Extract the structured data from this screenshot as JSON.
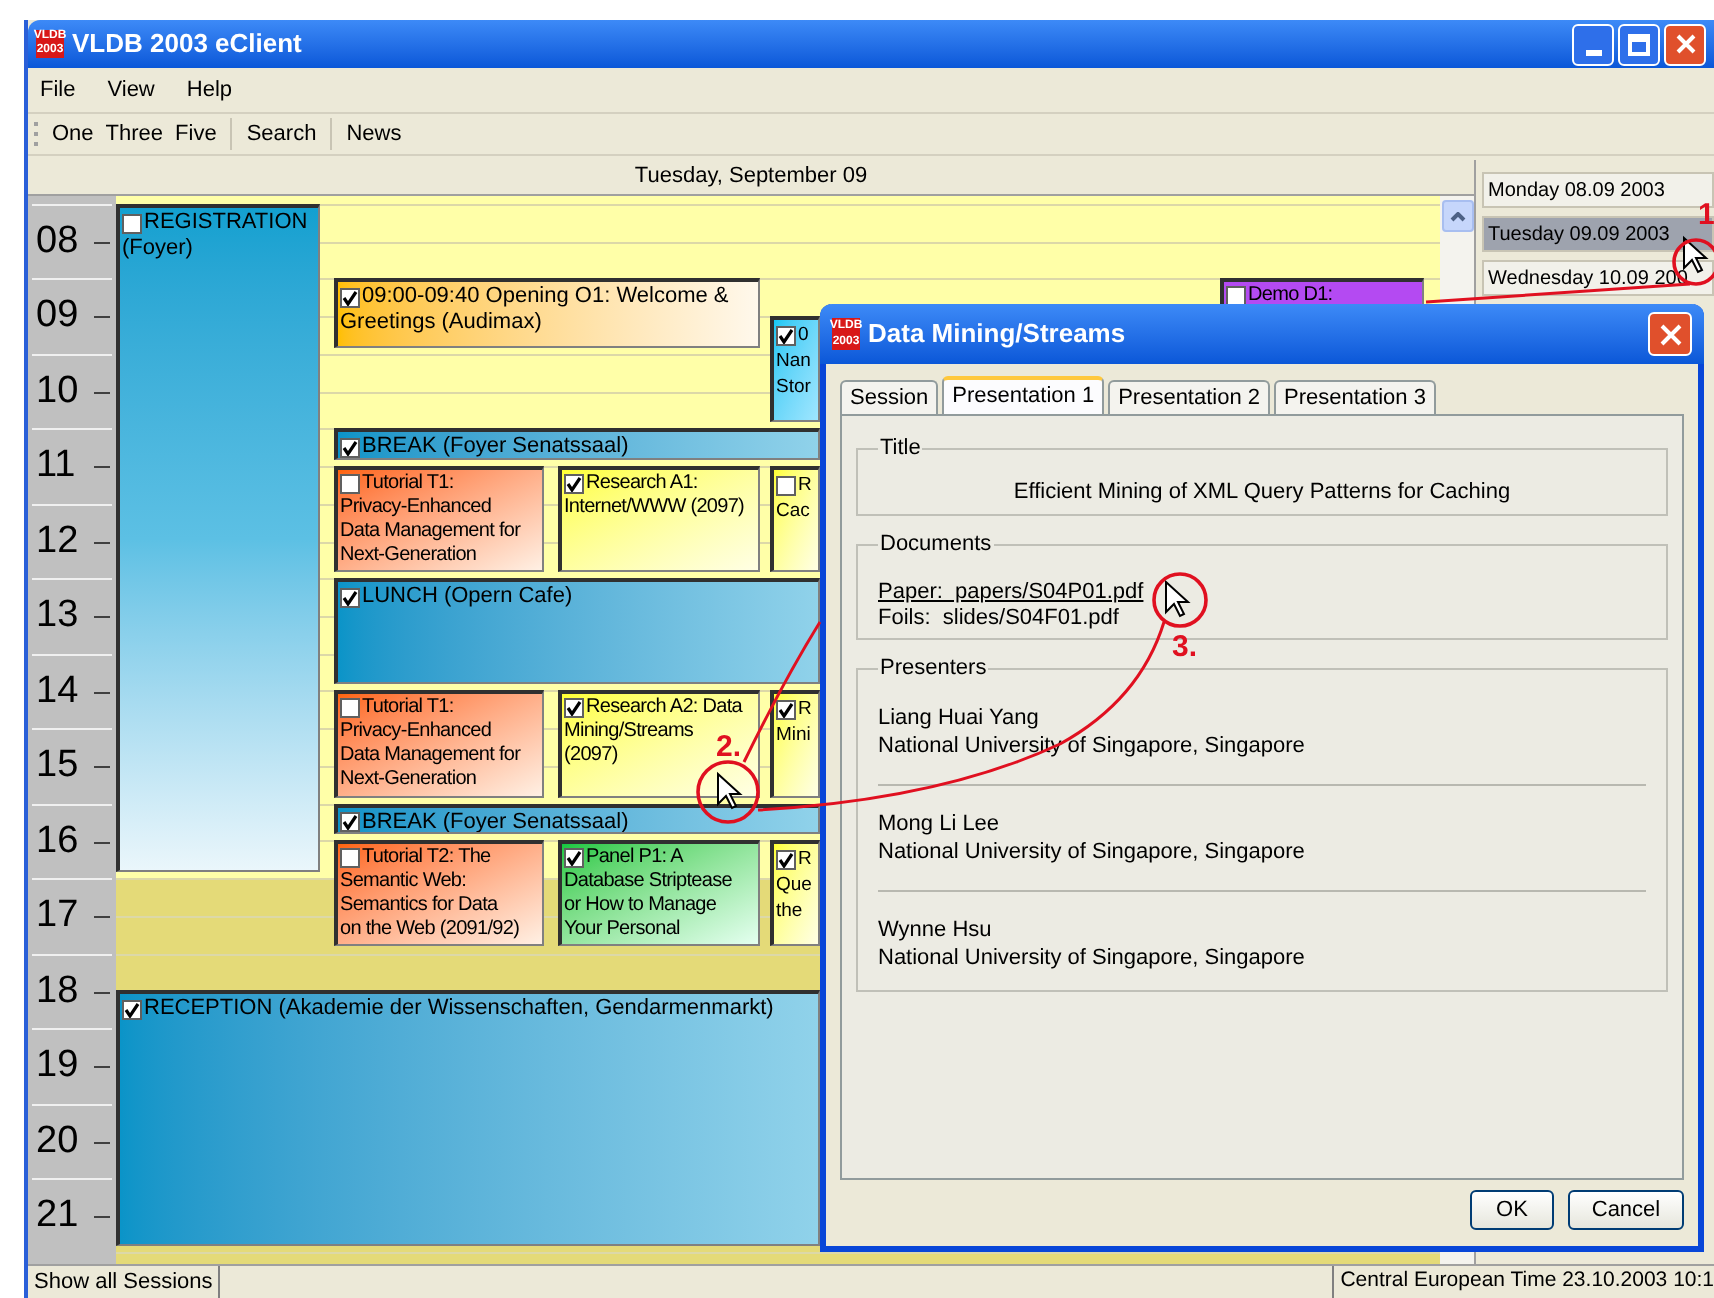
{
  "window": {
    "logo": [
      "VLDB",
      "2003"
    ],
    "title": "VLDB 2003 eClient"
  },
  "menu": [
    {
      "label": "File"
    },
    {
      "label": "View"
    },
    {
      "label": "Help"
    }
  ],
  "toolbar": [
    [
      "One",
      "Three",
      "Five"
    ],
    [
      "Search"
    ],
    [
      "News"
    ]
  ],
  "calendar": {
    "date": "Tuesday, September 09",
    "hours": [
      "08",
      "09",
      "10",
      "11",
      "12",
      "13",
      "14",
      "15",
      "16",
      "17",
      "18",
      "19",
      "20",
      "21"
    ],
    "events": [
      {
        "kind": "registration",
        "checked": false,
        "lines": [
          "REGISTRATION",
          "(Foyer)"
        ]
      },
      {
        "kind": "opening",
        "checked": true,
        "lines": [
          "09:00-09:40 Opening O1: Welcome &",
          "Greetings (Audimax)"
        ]
      },
      {
        "kind": "plenary",
        "checked": true,
        "lines": [
          "0",
          "Nan",
          "Stor"
        ]
      },
      {
        "kind": "demo",
        "checked": false,
        "lines": [
          "Demo D1:"
        ]
      },
      {
        "kind": "break",
        "checked": true,
        "lines": [
          "BREAK (Foyer Senatssaal)"
        ]
      },
      {
        "kind": "tutorial",
        "checked": false,
        "lines": [
          "Tutorial T1:",
          "Privacy-Enhanced",
          "Data Management for",
          "Next-Generation"
        ]
      },
      {
        "kind": "research",
        "checked": true,
        "lines": [
          "Research A1:",
          "Internet/WWW (2097)"
        ]
      },
      {
        "kind": "research",
        "checked": false,
        "lines": [
          "R",
          "Cac"
        ]
      },
      {
        "kind": "break",
        "checked": true,
        "lines": [
          "LUNCH (Opern Cafe)"
        ]
      },
      {
        "kind": "tutorial",
        "checked": false,
        "lines": [
          "Tutorial T1:",
          "Privacy-Enhanced",
          "Data Management for",
          "Next-Generation"
        ]
      },
      {
        "kind": "research",
        "checked": true,
        "lines": [
          "Research A2: Data",
          "Mining/Streams",
          "(2097)"
        ]
      },
      {
        "kind": "research",
        "checked": true,
        "lines": [
          "R",
          "Mini"
        ]
      },
      {
        "kind": "break",
        "checked": true,
        "lines": [
          "BREAK (Foyer Senatssaal)"
        ]
      },
      {
        "kind": "tutorial",
        "checked": false,
        "lines": [
          "Tutorial T2: The",
          "Semantic Web:",
          "Semantics for Data",
          "on the Web (2091/92)"
        ]
      },
      {
        "kind": "panel",
        "checked": true,
        "lines": [
          "Panel P1: A",
          "Database Striptease",
          "or How to Manage",
          "Your Personal"
        ]
      },
      {
        "kind": "research",
        "checked": true,
        "lines": [
          "R",
          "Que",
          "the"
        ]
      },
      {
        "kind": "break",
        "checked": true,
        "lines": [
          "RECEPTION (Akademie der Wissenschaften, Gendarmenmarkt)"
        ]
      }
    ]
  },
  "days": [
    {
      "label": "Monday 08.09 2003",
      "selected": false
    },
    {
      "label": "Tuesday 09.09 2003",
      "selected": true
    },
    {
      "label": "Wednesday 10.09 200",
      "selected": false
    }
  ],
  "status_bar": {
    "left": "Show all Sessions",
    "right": "Central European Time 23.10.2003 10:1"
  },
  "dialog": {
    "logo": [
      "VLDB",
      "2003"
    ],
    "title": "Data Mining/Streams",
    "tabs": [
      {
        "label": "Session",
        "selected": false
      },
      {
        "label": "Presentation 1",
        "selected": true
      },
      {
        "label": "Presentation 2",
        "selected": false
      },
      {
        "label": "Presentation 3",
        "selected": false
      }
    ],
    "title_group": {
      "legend": "Title",
      "text": "Efficient Mining of XML Query Patterns for Caching"
    },
    "documents": {
      "legend": "Documents",
      "items": [
        {
          "kind": "link",
          "text": "Paper:  papers/S04P01.pdf"
        },
        {
          "kind": "text",
          "text": "Foils:  slides/S04F01.pdf"
        }
      ]
    },
    "presenters": {
      "legend": "Presenters",
      "items": [
        {
          "name": "Liang Huai Yang",
          "affiliation": "National University of Singapore, Singapore"
        },
        {
          "name": "Mong Li Lee",
          "affiliation": "National University of Singapore, Singapore"
        },
        {
          "name": "Wynne Hsu",
          "affiliation": "National University of Singapore, Singapore"
        }
      ]
    },
    "buttons": [
      "OK",
      "Cancel"
    ]
  },
  "annotations": [
    {
      "label": "1"
    },
    {
      "label": "2."
    },
    {
      "label": "3."
    }
  ]
}
